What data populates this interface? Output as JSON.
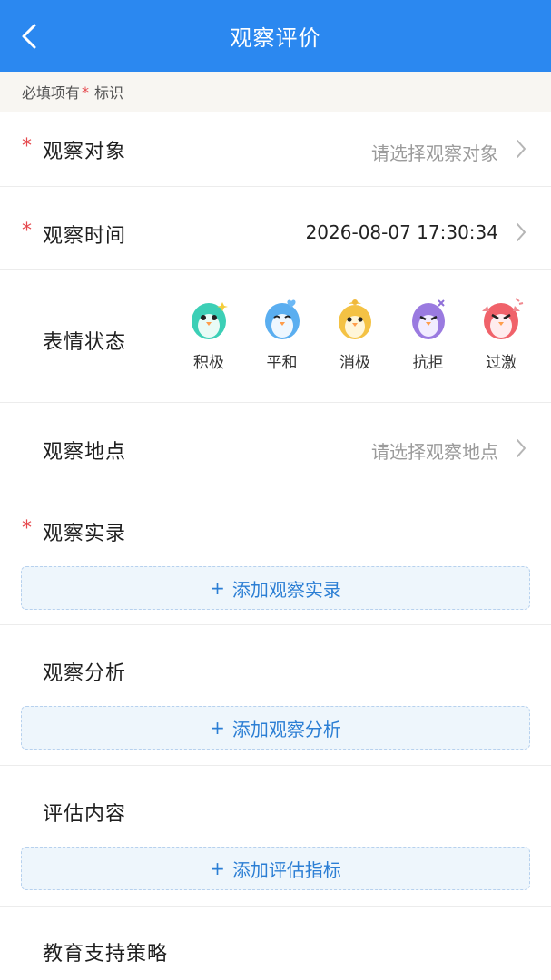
{
  "navbar": {
    "title": "观察评价"
  },
  "hint": {
    "prefix": "必填项有",
    "star": "*",
    "suffix": "标识"
  },
  "fields": {
    "target": {
      "required": "*",
      "label": "观察对象",
      "placeholder": "请选择观察对象"
    },
    "time": {
      "required": "*",
      "label": "观察时间",
      "value": "2026-08-07 17:30:34"
    },
    "mood": {
      "label": "表情状态",
      "options": [
        {
          "label": "积极",
          "icon": "penguin-teal-icon",
          "color": "#3ccfb6"
        },
        {
          "label": "平和",
          "icon": "penguin-blue-icon",
          "color": "#5aaef0"
        },
        {
          "label": "消极",
          "icon": "penguin-yellow-icon",
          "color": "#f4c244"
        },
        {
          "label": "抗拒",
          "icon": "penguin-purple-icon",
          "color": "#9a7ae0"
        },
        {
          "label": "过激",
          "icon": "penguin-red-icon",
          "color": "#f0626a"
        }
      ]
    },
    "location": {
      "label": "观察地点",
      "placeholder": "请选择观察地点"
    },
    "record": {
      "required": "*",
      "label": "观察实录",
      "add_label": "添加观察实录"
    },
    "analysis": {
      "label": "观察分析",
      "add_label": "添加观察分析"
    },
    "assessment": {
      "label": "评估内容",
      "add_label": "添加评估指标"
    },
    "strategy": {
      "label": "教育支持策略"
    }
  },
  "add_symbol": "+",
  "colors": {
    "primary": "#2b88f0",
    "required": "#e5484d",
    "add_text": "#2b7ed4"
  }
}
